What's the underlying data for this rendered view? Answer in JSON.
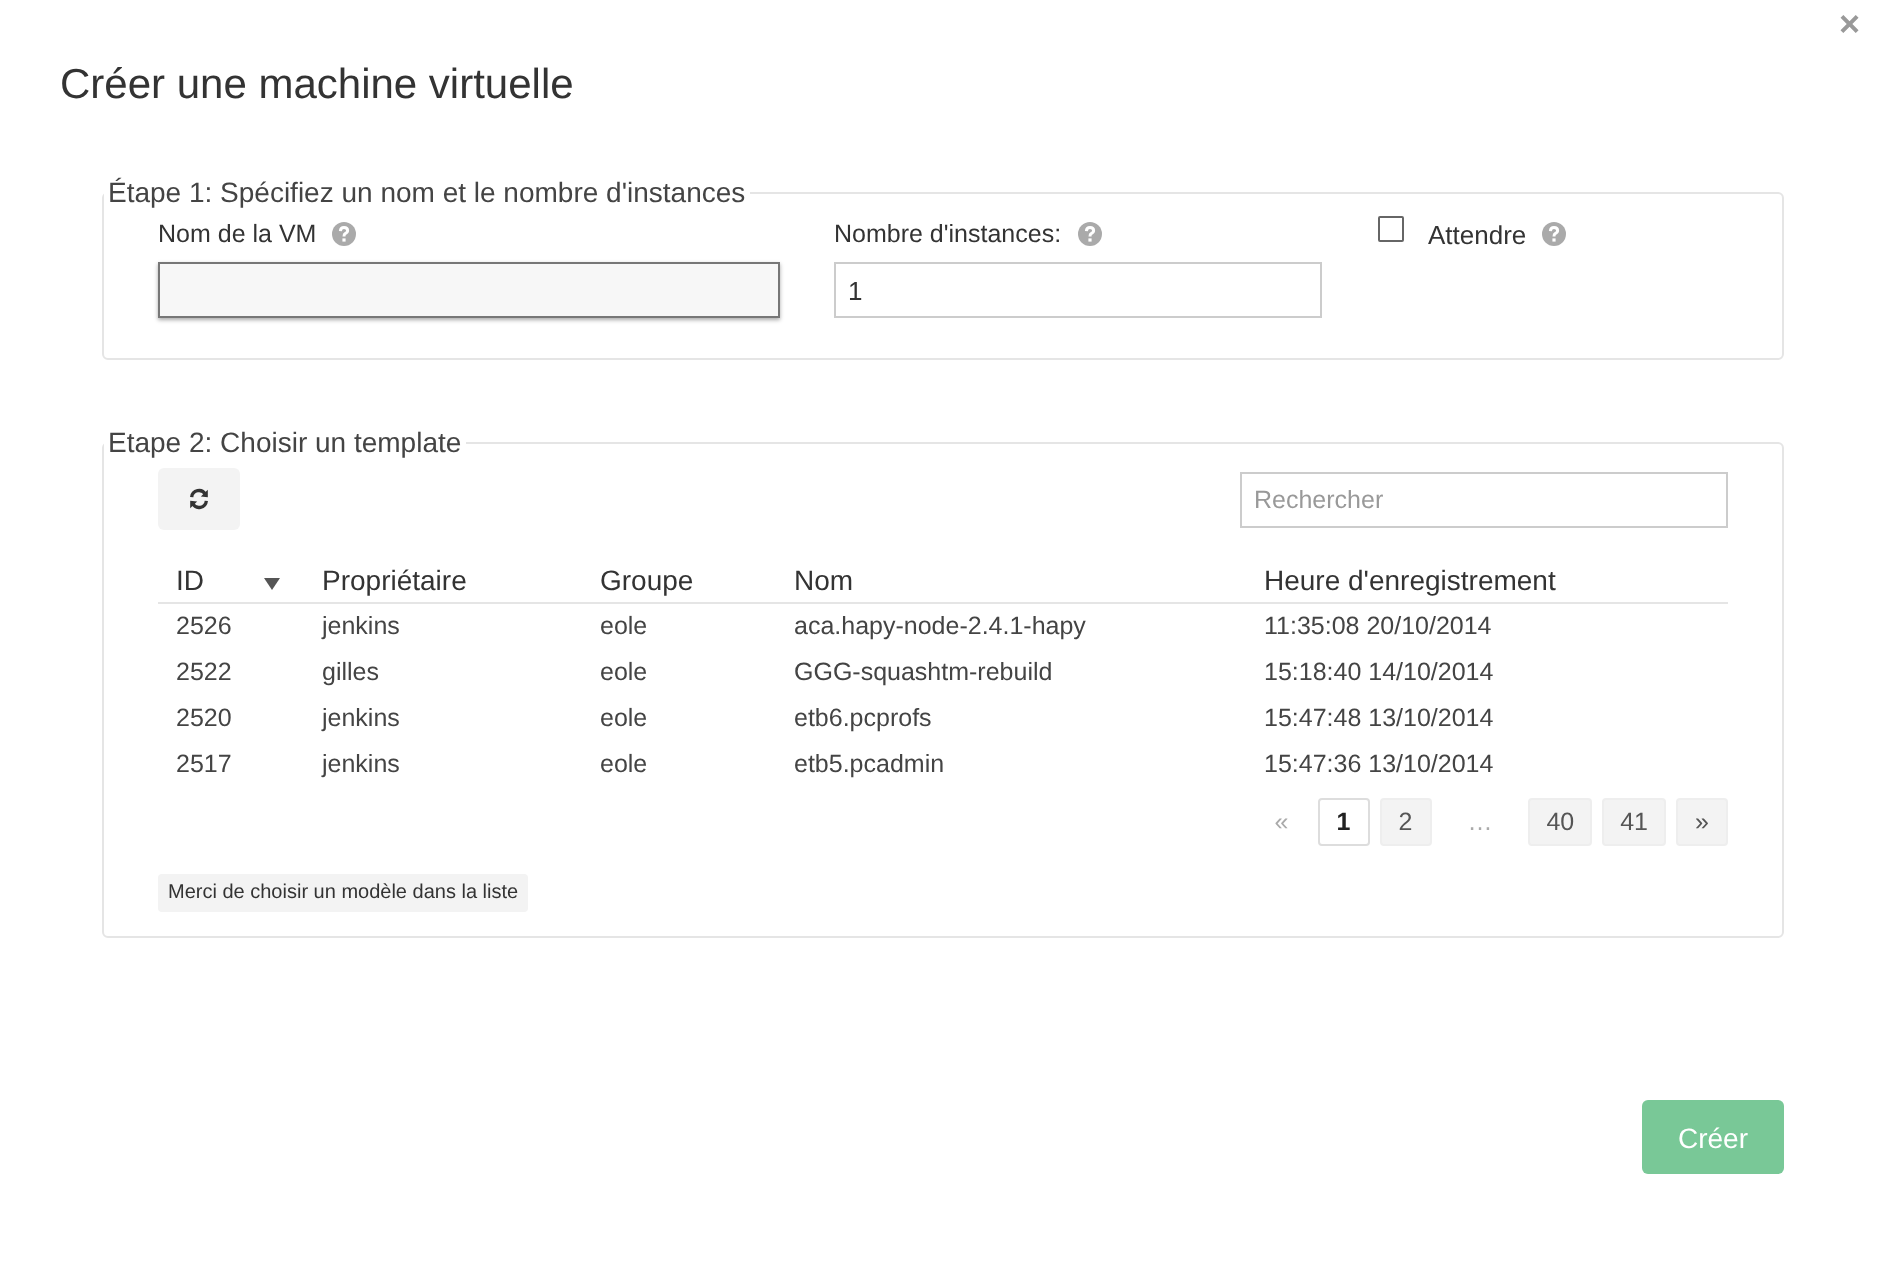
{
  "dialog": {
    "title": "Créer une machine virtuelle",
    "close": "×"
  },
  "step1": {
    "legend": "Étape 1: Spécifiez un nom et le nombre d'instances",
    "name_field": {
      "label": "Nom de la VM",
      "focused": true
    },
    "count_field": {
      "label": "Nombre d'instances:",
      "value": "1"
    },
    "wait_checkbox": {
      "label": "Attendre",
      "checked": false
    }
  },
  "step2": {
    "legend": "Etape 2: Choisir un template",
    "search": {
      "placeholder": "Rechercher"
    },
    "table": {
      "columns": [
        {
          "label": "ID",
          "sorted": true
        },
        {
          "label": "Propriétaire",
          "sorted": false
        },
        {
          "label": "Groupe",
          "sorted": false
        },
        {
          "label": "Nom",
          "sorted": false
        },
        {
          "label": "Heure d'enregistrement",
          "sorted": false
        }
      ],
      "rows": [
        [
          "2526",
          "jenkins",
          "eole",
          "aca.hapy-node-2.4.1-hapy",
          "11:35:08 20/10/2014"
        ],
        [
          "2522",
          "gilles",
          "eole",
          "GGG-squashtm-rebuild",
          "15:18:40 14/10/2014"
        ],
        [
          "2520",
          "jenkins",
          "eole",
          "etb6.pcprofs",
          "15:47:48 13/10/2014"
        ],
        [
          "2517",
          "jenkins",
          "eole",
          "etb5.pcadmin",
          "15:47:36 13/10/2014"
        ]
      ]
    },
    "pagination": [
      {
        "label": "«",
        "kind": "page",
        "selected": false,
        "disabled": true
      },
      {
        "label": "1",
        "kind": "page",
        "selected": true,
        "disabled": false
      },
      {
        "label": "2",
        "kind": "page",
        "selected": false,
        "disabled": false
      },
      {
        "label": "…",
        "kind": "ellipsis",
        "disabled": true
      },
      {
        "label": "40",
        "kind": "page",
        "selected": false,
        "disabled": false
      },
      {
        "label": "41",
        "kind": "page",
        "selected": false,
        "disabled": false
      },
      {
        "label": "»",
        "kind": "page",
        "selected": false,
        "disabled": false
      }
    ],
    "hint": "Merci de choisir un modèle dans la liste"
  },
  "buttons": [
    {
      "label": "Créer"
    }
  ]
}
